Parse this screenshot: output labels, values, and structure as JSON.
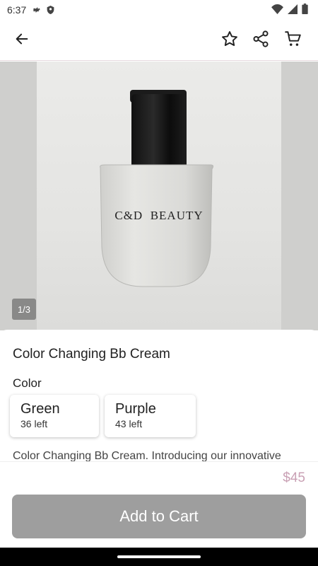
{
  "status_bar": {
    "time": "6:37",
    "left_icons": [
      "gear-icon",
      "shield-icon"
    ],
    "right_icons": [
      "wifi-icon",
      "signal-icon",
      "battery-icon"
    ]
  },
  "app_bar": {
    "icons": [
      "back-arrow-icon",
      "star-icon",
      "share-icon",
      "cart-icon"
    ]
  },
  "gallery": {
    "counter": "1/3",
    "product_label": "C&D  BEAUTY"
  },
  "product": {
    "title": "Color Changing Bb Cream",
    "color_label": "Color",
    "options": [
      {
        "name": "Green",
        "stock": "36 left"
      },
      {
        "name": "Purple",
        "stock": "43 left"
      }
    ],
    "description": "Color Changing Bb Cream. Introducing our innovative"
  },
  "footer": {
    "price": "$45",
    "add_to_cart": "Add to Cart"
  },
  "colors": {
    "price": "#c9a0b4",
    "button": "#9e9e9e",
    "divider": "#e6d9de"
  }
}
